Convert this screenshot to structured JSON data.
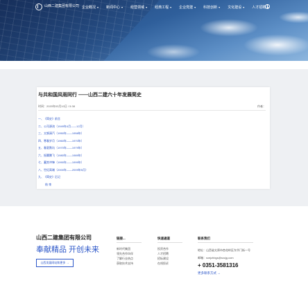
{
  "nav": {
    "logo_text": "山西二建集团有限公司",
    "items": [
      {
        "label": "企业概况",
        "chevron": "▾"
      },
      {
        "label": "新闻中心",
        "chevron": "▾"
      },
      {
        "label": "经营领域",
        "chevron": "▾"
      },
      {
        "label": "经典工程",
        "chevron": "▾"
      },
      {
        "label": "企业党建",
        "chevron": "▾"
      },
      {
        "label": "科技创新",
        "chevron": "▾"
      },
      {
        "label": "文化建设",
        "chevron": "▾"
      },
      {
        "label": "人才招聘",
        "chevron": "▾"
      }
    ]
  },
  "article": {
    "title": "与共和国风雨同行 ——山西二建六十年发展简史",
    "meta": "时间：2020年03月10日 / 5:38",
    "author": "作者：",
    "toc": [
      "一、《简史》前言",
      "二、公司源流（1949年4月——12月）",
      "三、太钢清汽（1950年——1958年）",
      "四、寒春岁月（1960年——1970年）",
      "五、春夏跌坑（1970年——1979年）",
      "六、振翼腾飞（1980年——1989年）",
      "七、蓄势冲锋（1990年——1999年）",
      "八、世纪高端（2000年——2009年5月）",
      "九、《简史》后记",
      "结 束"
    ]
  },
  "footer": {
    "company": "山西二建集团有限公司",
    "slogan": "奉献精品 开创未来",
    "more_button": "山西发展网站和更多 →",
    "columns": [
      {
        "heading": "链接...",
        "links": [
          "新时代集团",
          "领先合作伙伴",
          "了解行业热点",
          "获取技术支持"
        ]
      },
      {
        "heading": "快速通道",
        "links": [
          "投资合作",
          "人才招聘",
          "招标建设",
          "在线投诉"
        ]
      }
    ],
    "contact": {
      "heading": "联系我们",
      "address": "地址：山西省太原市杏花岭区东华门街一号",
      "email": "邮箱：sxejzhbgs@sxcjg.com",
      "phone": "+ 0351-3581316",
      "more": "更多联系方式 →"
    }
  }
}
